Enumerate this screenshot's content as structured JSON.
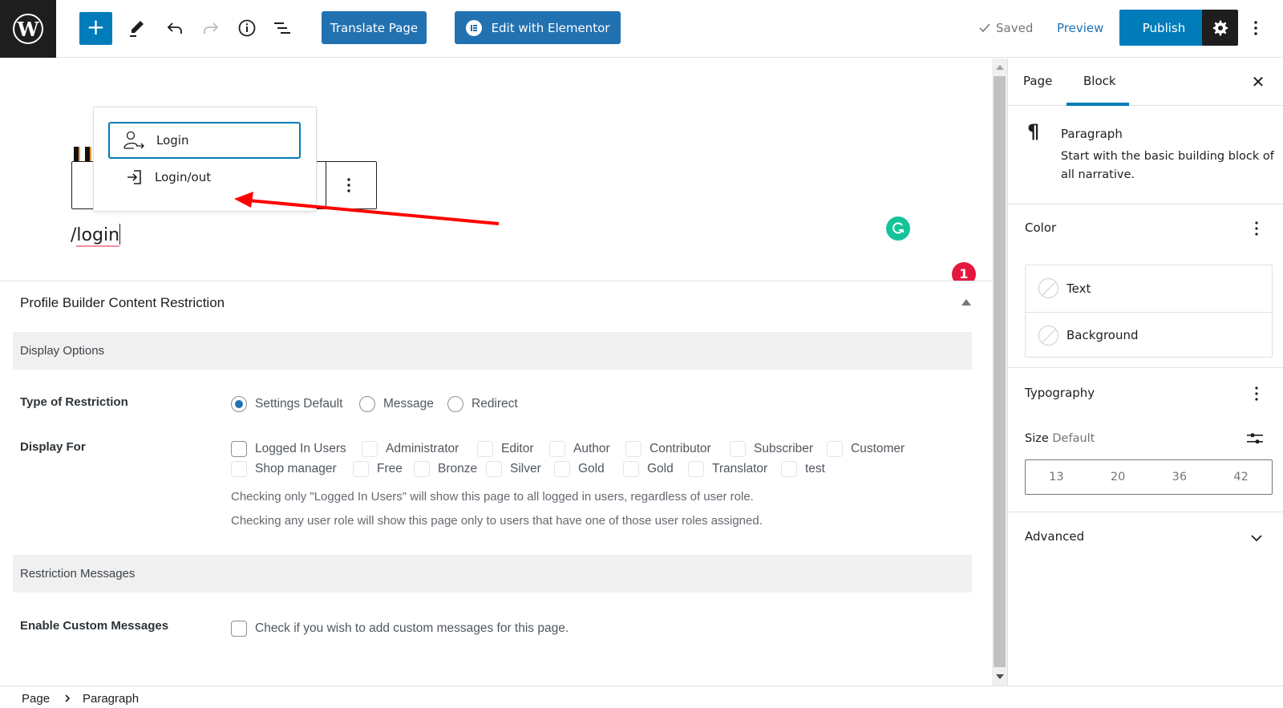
{
  "topbar": {
    "logo": "W",
    "add_block_label": "+",
    "translate_label": "Translate Page",
    "elementor_label": "Edit with Elementor",
    "saved_label": "Saved",
    "preview_label": "Preview",
    "publish_label": "Publish",
    "icons": [
      "wordpress-logo",
      "plus-icon",
      "pencil-icon",
      "undo-icon",
      "redo-icon",
      "info-icon",
      "list-view-icon",
      "elementor-icon",
      "check-icon",
      "gear-icon",
      "kebab-icon"
    ]
  },
  "editor": {
    "typed_text_prefix": "/",
    "typed_text_word": "login",
    "autocomplete": [
      {
        "label": "Login",
        "icon": "user-login-icon",
        "selected": true
      },
      {
        "label": "Login/out",
        "icon": "sign-in-icon",
        "selected": false
      }
    ],
    "notification_count": "1",
    "arrow_color": "#ff0000"
  },
  "metabox": {
    "title": "Profile Builder Content Restriction",
    "display_options_title": "Display Options",
    "type_of_restriction_label": "Type of Restriction",
    "restriction_types": [
      {
        "label": "Settings Default",
        "checked": true
      },
      {
        "label": "Message",
        "checked": false
      },
      {
        "label": "Redirect",
        "checked": false
      }
    ],
    "display_for_label": "Display For",
    "roles_row1": [
      "Logged In Users",
      "Administrator",
      "Editor",
      "Author",
      "Contributor",
      "Subscriber",
      "Customer"
    ],
    "roles_row2": [
      "Shop manager",
      "Free",
      "Bronze",
      "Silver",
      "Gold",
      "Gold",
      "Translator",
      "test"
    ],
    "help_1": "Checking only \"Logged In Users\" will show this page to all logged in users, regardless of user role.",
    "help_2": "Checking any user role will show this page only to users that have one of those user roles assigned.",
    "restriction_messages_title": "Restriction Messages",
    "enable_custom_label": "Enable Custom Messages",
    "enable_custom_desc": "Check if you wish to add custom messages for this page."
  },
  "sidebar": {
    "tabs": [
      {
        "label": "Page"
      },
      {
        "label": "Block",
        "active": true
      }
    ],
    "close_label": "✕",
    "block_name": "Paragraph",
    "block_desc": "Start with the basic building block of all narrative.",
    "color_title": "Color",
    "color_items": [
      "Text",
      "Background"
    ],
    "typography_title": "Typography",
    "size_label": "Size",
    "size_value": "Default",
    "size_presets": [
      "13",
      "20",
      "36",
      "42"
    ],
    "advanced_title": "Advanced"
  },
  "footer": {
    "breadcrumb": [
      "Page",
      "Paragraph"
    ]
  },
  "colors": {
    "accent": "#007cba",
    "wp_blue": "#2271b1",
    "dark": "#1e1e1e",
    "grammarly": "#15c39a",
    "notification": "#e5173f"
  }
}
